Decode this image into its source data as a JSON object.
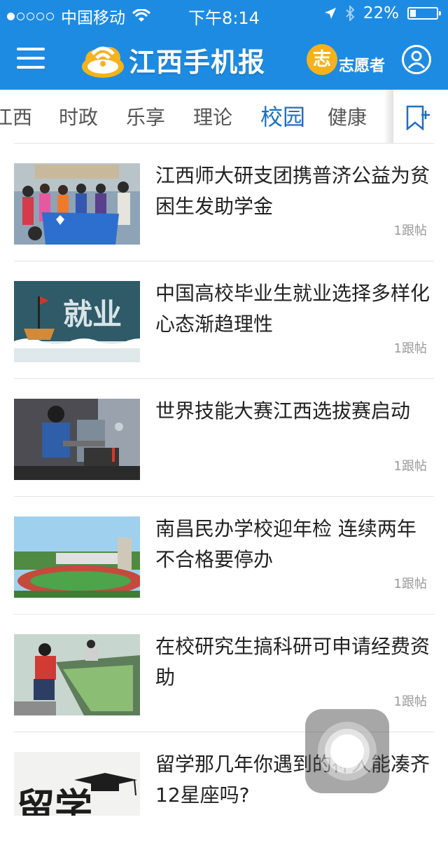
{
  "status_bar": {
    "carrier": "中国移动",
    "time": "下午8:14",
    "battery": "22%",
    "battery_level": 0.22
  },
  "navbar": {
    "logo_text": "江西手机报",
    "volunteer_label": "志愿者",
    "volunteer_icon_char": "志"
  },
  "tabs": [
    {
      "label": "江西"
    },
    {
      "label": "时政"
    },
    {
      "label": "乐享"
    },
    {
      "label": "理论"
    },
    {
      "label": "校园"
    },
    {
      "label": "健康"
    }
  ],
  "articles": [
    {
      "title": "江西师大研支团携普济公益为贫困生发助学金",
      "replies": "1跟帖"
    },
    {
      "title": "中国高校毕业生就业选择多样化 心态渐趋理性",
      "replies": "1跟帖",
      "thumb_text": "就业"
    },
    {
      "title": "世界技能大赛江西选拔赛启动",
      "replies": "1跟帖"
    },
    {
      "title": "南昌民办学校迎年检 连续两年不合格要停办",
      "replies": "1跟帖"
    },
    {
      "title": "在校研究生搞科研可申请经费资助",
      "replies": "1跟帖"
    },
    {
      "title": "留学那几年你遇到的神人能凑齐12星座吗?",
      "replies": "",
      "thumb_text": "留学"
    }
  ],
  "colors": {
    "brand_blue": "#1e8be2",
    "active_tab": "#1e6fc1",
    "volunteer_orange": "#f5b21b"
  }
}
